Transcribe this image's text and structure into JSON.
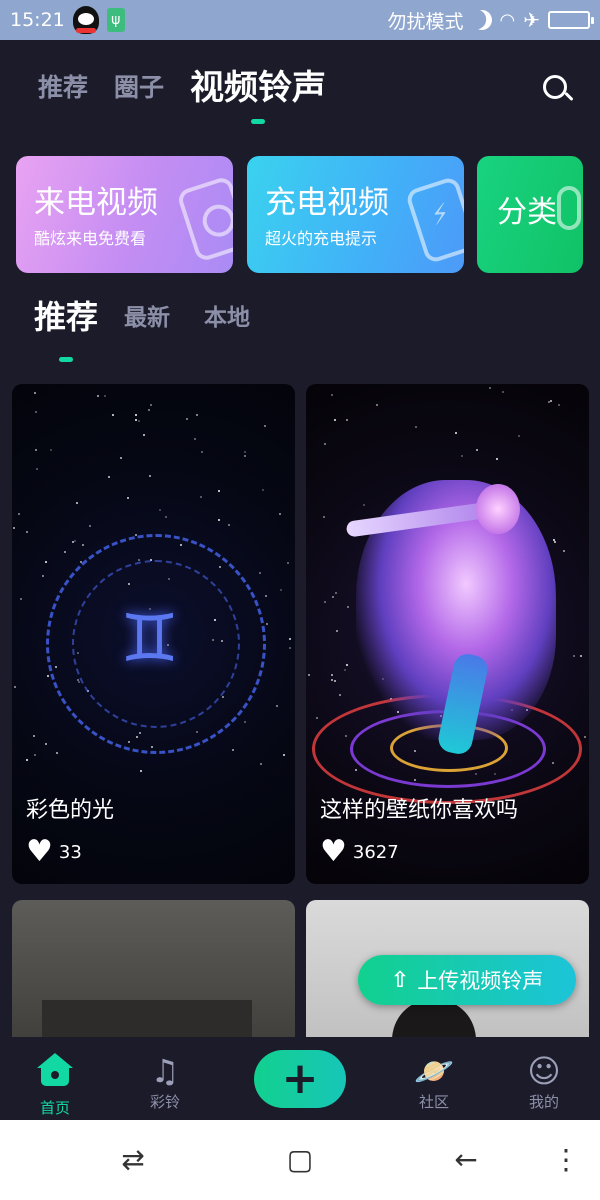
{
  "status_bar": {
    "time": "15:21",
    "dnd_text": "勿扰模式",
    "icons": [
      "qq-icon",
      "usb-icon",
      "moon-icon",
      "wifi-icon",
      "airplane-icon",
      "battery-icon"
    ]
  },
  "top_tabs": [
    {
      "label": "推荐",
      "active": false
    },
    {
      "label": "圈子",
      "active": false
    },
    {
      "label": "视频铃声",
      "active": true
    }
  ],
  "banners": [
    {
      "title": "来电视频",
      "subtitle": "酷炫来电免费看"
    },
    {
      "title": "充电视频",
      "subtitle": "超火的充电提示"
    },
    {
      "title": "分类"
    }
  ],
  "sub_tabs": [
    {
      "label": "推荐",
      "active": true
    },
    {
      "label": "最新",
      "active": false
    },
    {
      "label": "本地",
      "active": false
    }
  ],
  "cards": [
    {
      "caption": "彩色的光",
      "likes": "33"
    },
    {
      "caption": "这样的壁纸你喜欢吗",
      "likes": "3627"
    }
  ],
  "upload_button": {
    "label": "上传视频铃声"
  },
  "bottom_nav": [
    {
      "label": "首页",
      "active": true
    },
    {
      "label": "彩铃",
      "active": false
    },
    {
      "label": "社区",
      "active": false
    },
    {
      "label": "我的",
      "active": false
    }
  ],
  "colors": {
    "accent": "#12d9a3",
    "background": "#1c1b2a"
  }
}
